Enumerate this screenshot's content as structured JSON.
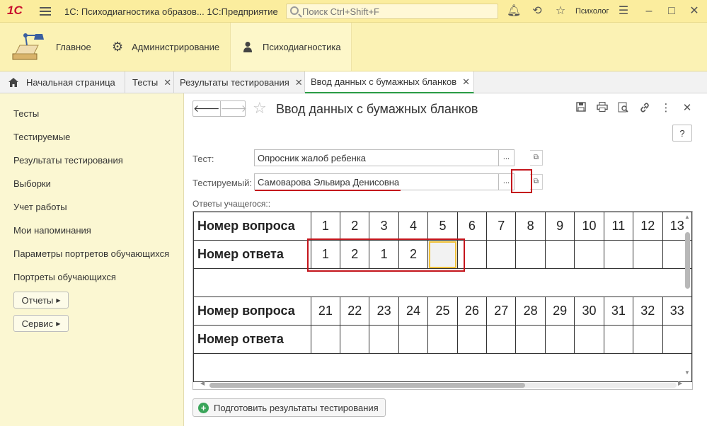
{
  "titlebar": {
    "logo": "1С",
    "app_title": "1С: Психодиагностика образов...  1С:Предприятие",
    "search_placeholder": "Поиск Ctrl+Shift+F",
    "user": "Психолог"
  },
  "sections": [
    {
      "label": "Главное",
      "icon": "desk-lamp-icon"
    },
    {
      "label": "Администрирование",
      "icon": "gear-icon"
    },
    {
      "label": "Психодиагностика",
      "icon": "person-icon"
    }
  ],
  "tabs": [
    {
      "label": "Начальная страница",
      "icon": "home-icon"
    },
    {
      "label": "Тесты",
      "closable": true
    },
    {
      "label": "Результаты тестирования",
      "closable": true
    },
    {
      "label": "Ввод данных с бумажных бланков",
      "closable": true,
      "active": true
    }
  ],
  "leftnav": {
    "items": [
      "Тесты",
      "Тестируемые",
      "Результаты тестирования",
      "Выборки",
      "Учет работы",
      "Мои напоминания",
      "Параметры портретов обучающихся",
      "Портреты обучающихся"
    ],
    "buttons": [
      "Отчеты",
      "Сервис"
    ]
  },
  "form": {
    "title": "Ввод данных с бумажных бланков",
    "help": "?",
    "test_label": "Тест:",
    "test_value": "Опросник жалоб ребенка",
    "subject_label": "Тестируемый:",
    "subject_value": "Самоварова Эльвира Денисовна",
    "dots": "...",
    "answers_label": "Ответы учащегося::",
    "prepare_button": "Подготовить результаты тестирования"
  },
  "grid": {
    "question_header": "Номер вопроса",
    "answer_header": "Номер ответа",
    "block1_questions": [
      "1",
      "2",
      "3",
      "4",
      "5",
      "6",
      "7",
      "8",
      "9",
      "10",
      "11",
      "12",
      "13"
    ],
    "block1_answers": [
      "1",
      "2",
      "1",
      "2",
      "",
      "",
      "",
      "",
      "",
      "",
      "",
      "",
      ""
    ],
    "block2_questions": [
      "21",
      "22",
      "23",
      "24",
      "25",
      "26",
      "27",
      "28",
      "29",
      "30",
      "31",
      "32",
      "33"
    ],
    "block2_answers": [
      "",
      "",
      "",
      "",
      "",
      "",
      "",
      "",
      "",
      "",
      "",
      "",
      ""
    ]
  },
  "colors": {
    "titlebar_bg": "#fbed9e",
    "accent_green": "#2a9b45",
    "annotation_red": "#c4151c"
  }
}
